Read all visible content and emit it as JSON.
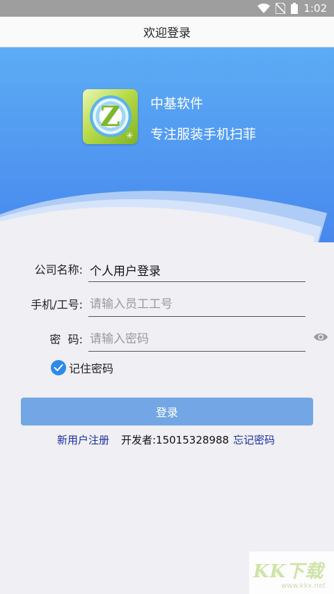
{
  "status_bar": {
    "time": "1:02",
    "icons": [
      "wifi-icon",
      "no-sim-icon",
      "battery-icon"
    ]
  },
  "header": {
    "title": "欢迎登录"
  },
  "brand": {
    "logo_letter": "Z",
    "name": "中基软件",
    "slogan": "专注服装手机扫菲"
  },
  "form": {
    "company": {
      "label": "公司名称:",
      "value": "个人用户登录"
    },
    "employee": {
      "label": "手机/工号:",
      "placeholder": "请输入员工工号"
    },
    "password": {
      "label": "密  码:",
      "placeholder": "请输入密码",
      "toggle_icon": "eye-icon"
    },
    "remember": {
      "label": "记住密码",
      "checked": true
    }
  },
  "login_button_label": "登录",
  "links": {
    "register": "新用户注册",
    "developer": "开发者:15015328988",
    "forgot": "忘记密码"
  },
  "watermark": {
    "text": "KK下载",
    "url": "www.kkx.net"
  },
  "colors": {
    "hero_top": "#5aa9f4",
    "hero_bottom": "#4a8ef0",
    "accent": "#2d8ae8",
    "button": "#73a6e4",
    "link": "#1a2fa3",
    "page_bg": "#efeff4"
  }
}
